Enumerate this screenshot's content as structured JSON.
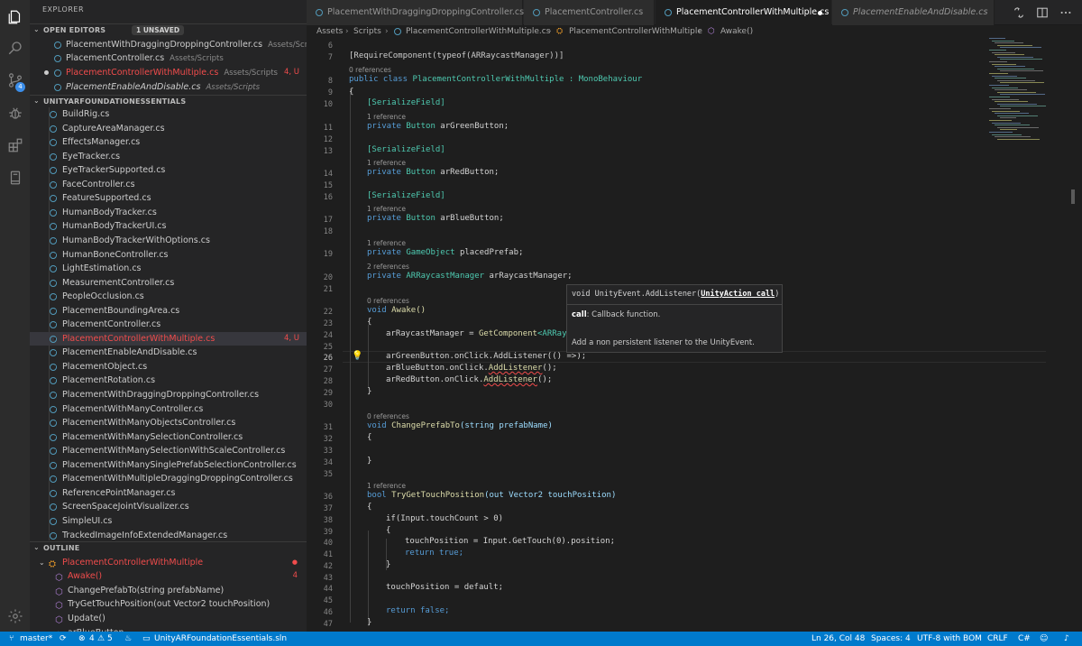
{
  "sidebar": {
    "title": "EXPLORER",
    "open_editors": {
      "label": "OPEN EDITORS",
      "badge": "1 UNSAVED",
      "items": [
        {
          "name": "PlacementWithDraggingDroppingController.cs",
          "path": "Assets/Scripts"
        },
        {
          "name": "PlacementController.cs",
          "path": "Assets/Scripts"
        },
        {
          "name": "PlacementControllerWithMultiple.cs",
          "path": "Assets/Scripts",
          "status": "4, U"
        },
        {
          "name": "PlacementEnableAndDisable.cs",
          "path": "Assets/Scripts"
        }
      ]
    },
    "project": {
      "label": "UNITYARFOUNDATIONESSENTIALS",
      "files": [
        "BuildRig.cs",
        "CaptureAreaManager.cs",
        "EffectsManager.cs",
        "EyeTracker.cs",
        "EyeTrackerSupported.cs",
        "FaceController.cs",
        "FeatureSupported.cs",
        "HumanBodyTracker.cs",
        "HumanBodyTrackerUI.cs",
        "HumanBodyTrackerWithOptions.cs",
        "HumanBoneController.cs",
        "LightEstimation.cs",
        "MeasurementController.cs",
        "PeopleOcclusion.cs",
        "PlacementBoundingArea.cs",
        "PlacementController.cs",
        "PlacementControllerWithMultiple.cs",
        "PlacementEnableAndDisable.cs",
        "PlacementObject.cs",
        "PlacementRotation.cs",
        "PlacementWithDraggingDroppingController.cs",
        "PlacementWithManyController.cs",
        "PlacementWithManyObjectsController.cs",
        "PlacementWithManySelectionController.cs",
        "PlacementWithManySelectionWithScaleController.cs",
        "PlacementWithManySinglePrefabSelectionController.cs",
        "PlacementWithMultipleDraggingDroppingController.cs",
        "ReferencePointManager.cs",
        "ScreenSpaceJointVisualizer.cs",
        "SimpleUI.cs",
        "TrackedImageInfoExtendedManager.cs"
      ],
      "selected_status": "4, U"
    },
    "outline": {
      "label": "OUTLINE",
      "class_name": "PlacementControllerWithMultiple",
      "members": [
        {
          "name": "Awake()",
          "count": "4"
        },
        {
          "name": "ChangePrefabTo(string prefabName)"
        },
        {
          "name": "TryGetTouchPosition(out Vector2 touchPosition)"
        },
        {
          "name": "Update()"
        },
        {
          "name": "arBlueButton"
        }
      ]
    }
  },
  "tabs": [
    {
      "label": "PlacementWithDraggingDroppingController.cs"
    },
    {
      "label": "PlacementController.cs"
    },
    {
      "label": "PlacementControllerWithMultiple.cs"
    },
    {
      "label": "PlacementEnableAndDisable.cs"
    }
  ],
  "breadcrumb": [
    "Assets",
    "Scripts",
    "PlacementControllerWithMultiple.cs",
    "PlacementControllerWithMultiple",
    "Awake()"
  ],
  "editor": {
    "line_numbers": [
      "6",
      "7",
      "8",
      "9",
      "10",
      "11",
      "12",
      "13",
      "14",
      "15",
      "16",
      "17",
      "18",
      "19",
      "20",
      "21",
      "22",
      "23",
      "24",
      "25",
      "26",
      "27",
      "28",
      "29",
      "30",
      "31",
      "32",
      "33",
      "34",
      "35",
      "36",
      "37",
      "38",
      "39",
      "40",
      "41",
      "42",
      "43",
      "44",
      "45",
      "46",
      "47"
    ],
    "refs": {
      "zero": "0 references",
      "one": "1 reference",
      "two": "2 references"
    },
    "code": {
      "require": "[RequireComponent(typeof(ARRaycastManager))]",
      "class_kw": "public class",
      "class_name": "PlacementControllerWithMultiple",
      "base": ": MonoBehaviour",
      "open": "{",
      "close": "}",
      "serialize": "[SerializeField]",
      "private": "private",
      "button_type": "Button",
      "green": "arGreenButton;",
      "red": "arRedButton;",
      "blue": "arBlueButton;",
      "go_type": "GameObject",
      "prefab": "placedPrefab;",
      "rm_type": "ARRaycastManager",
      "rm_field": "arRaycastManager;",
      "void": "void",
      "awake": "Awake()",
      "l24_a": "arRaycastManager = ",
      "l24_b": "GetComponent",
      "l24_c": "<ARRayca",
      "l26": "arGreenButton.onClick.AddListener(() =>);",
      "l27_a": "arBlueButton.onClick.",
      "l27_b": "AddListener",
      "l27_c": "();",
      "l28_a": "arRedButton.onClick.",
      "l28_b": "AddListener",
      "l28_c": "();",
      "change": "ChangePrefabTo",
      "change_args": "(string prefabName)",
      "bool": "bool",
      "try": "TryGetTouchPosition",
      "try_args": "(out Vector2 touchPosition)",
      "l38": "if(Input.touchCount > 0)",
      "l40": "touchPosition = Input.GetTouch(0).position;",
      "l41_kw": "return",
      "l41_v": "true;",
      "l44": "touchPosition = default;",
      "l46_kw": "return",
      "l46_v": "false;"
    }
  },
  "hover": {
    "signature_prefix": "void UnityEvent.AddListener(",
    "signature_param": "UnityAction call",
    "signature_suffix": ")",
    "param_name": "call",
    "param_desc": ": Callback function.",
    "summary": "Add a non persistent listener to the UnityEvent."
  },
  "status": {
    "branch": "master*",
    "errors": "4",
    "warnings": "5",
    "solution": "UnityARFoundationEssentials.sln",
    "position": "Ln 26, Col 48",
    "spaces": "Spaces: 4",
    "encoding": "UTF-8 with BOM",
    "eol": "CRLF",
    "language": "C#"
  },
  "activity_badges": {
    "scm": "4"
  },
  "colors": {
    "accent": "#007acc",
    "error": "#f14c4c",
    "keyword": "#569cd6",
    "type": "#4ec9b0"
  }
}
